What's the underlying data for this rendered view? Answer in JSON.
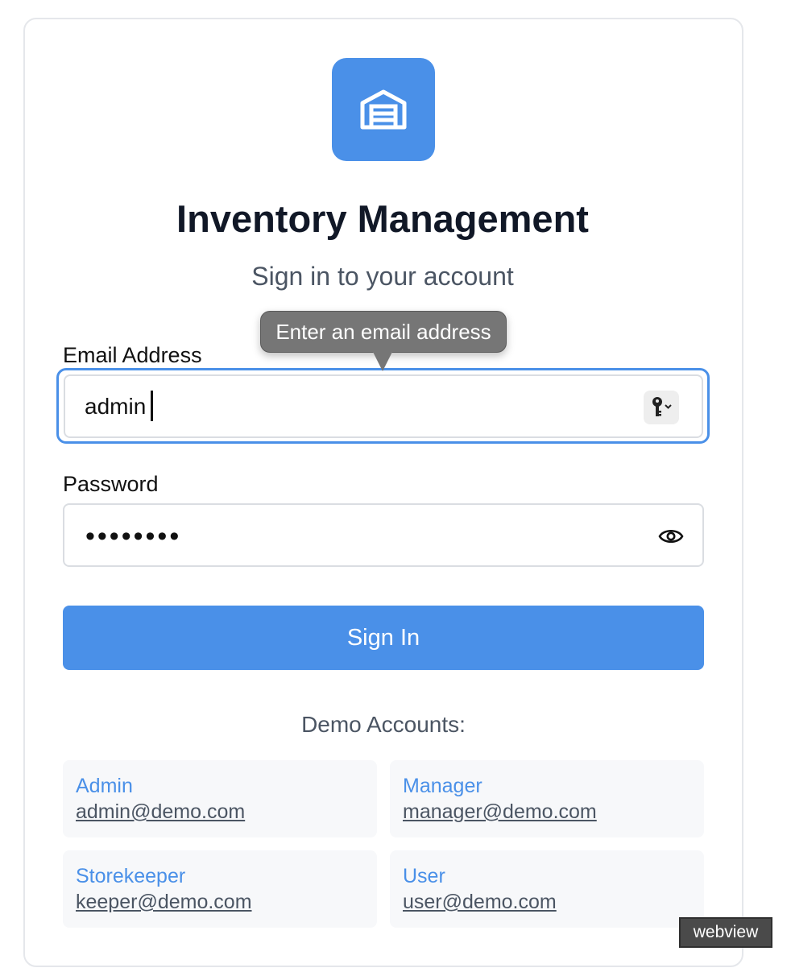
{
  "app": {
    "title": "Inventory Management",
    "subtitle": "Sign in to your account",
    "logo_icon": "warehouse-icon"
  },
  "form": {
    "email_label": "Email Address",
    "email_value": "admin",
    "email_tooltip": "Enter an email address",
    "password_label": "Password",
    "password_value": "••••••••",
    "submit_label": "Sign In"
  },
  "demo": {
    "title": "Demo Accounts:",
    "accounts": [
      {
        "role": "Admin",
        "email": "admin@demo.com"
      },
      {
        "role": "Manager",
        "email": "manager@demo.com"
      },
      {
        "role": "Storekeeper",
        "email": "keeper@demo.com"
      },
      {
        "role": "User",
        "email": "user@demo.com"
      }
    ]
  },
  "overlay": {
    "webview_badge": "webview"
  },
  "colors": {
    "accent": "#4a90e8",
    "title_text": "#111827",
    "muted_text": "#4b5563",
    "demo_card_bg": "#f7f8fa"
  }
}
